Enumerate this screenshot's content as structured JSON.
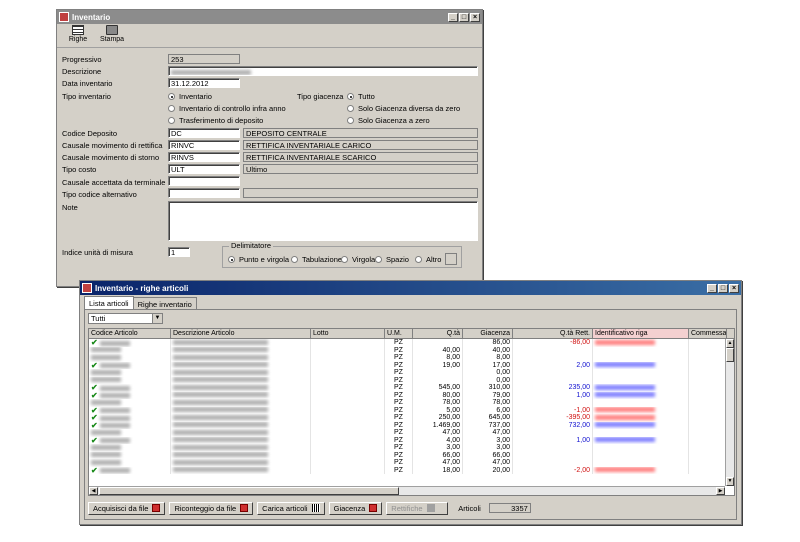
{
  "win1": {
    "title": "Inventario",
    "toolbar": {
      "righe": "Righe",
      "stampa": "Stampa"
    },
    "labels": {
      "progressivo": "Progressivo",
      "descrizione": "Descrizione",
      "data": "Data inventario",
      "tipo_inv": "Tipo inventario",
      "tipo_giac": "Tipo giacenza",
      "codice_deposito": "Codice Deposito",
      "causale_rettifica": "Causale movimento di rettifica",
      "causale_storno": "Causale movimento di storno",
      "tipo_costo": "Tipo costo",
      "causale_terminale": "Causale accettata da terminale",
      "tipo_codice_alt": "Tipo codice alternativo",
      "note": "Note",
      "indice_um": "Indice unità di misura"
    },
    "values": {
      "progressivo": "253",
      "data": "31.12.2012",
      "codice_deposito": "DC",
      "codice_deposito_desc": "DEPOSITO CENTRALE",
      "causale_rettifica": "RINVC",
      "causale_rettifica_desc": "RETTIFICA INVENTARIALE CARICO",
      "causale_storno": "RINVS",
      "causale_storno_desc": "RETTIFICA INVENTARIALE SCARICO",
      "tipo_costo": "ULT",
      "tipo_costo_desc": "Ultimo",
      "indice_um": "1"
    },
    "tipo_inventario": [
      "Inventario",
      "Inventario di controllo infra anno",
      "Trasferimento di deposito"
    ],
    "tipo_giacenza": [
      "Tutto",
      "Solo Giacenza diversa da zero",
      "Solo Giacenza a zero"
    ],
    "delimitatore": {
      "title": "Delimitatore",
      "options": [
        "Punto e virgola",
        "Tabulazione",
        "Virgola",
        "Spazio",
        "Altro"
      ]
    }
  },
  "win2": {
    "title": "Inventario - righe articoli",
    "tabs": [
      "Lista articoli",
      "Righe inventario"
    ],
    "filter": "Tutti",
    "columns": [
      "Codice Articolo",
      "Descrizione Articolo",
      "Lotto",
      "U.M.",
      "Q.tà",
      "Giacenza",
      "Q.tà Rett.",
      "Identificativo riga",
      "Commessa"
    ],
    "rows": [
      {
        "check": true,
        "um": "PZ",
        "qta": "",
        "giac": "86,00",
        "rett": "-86,00",
        "rc": "neg"
      },
      {
        "check": false,
        "um": "PZ",
        "qta": "40,00",
        "giac": "40,00",
        "rett": "",
        "rc": ""
      },
      {
        "check": false,
        "um": "PZ",
        "qta": "8,00",
        "giac": "8,00",
        "rett": "",
        "rc": ""
      },
      {
        "check": true,
        "um": "PZ",
        "qta": "19,00",
        "giac": "17,00",
        "rett": "2,00",
        "rc": "pos"
      },
      {
        "check": false,
        "um": "PZ",
        "qta": "",
        "giac": "0,00",
        "rett": "",
        "rc": ""
      },
      {
        "check": false,
        "um": "PZ",
        "qta": "",
        "giac": "0,00",
        "rett": "",
        "rc": ""
      },
      {
        "check": true,
        "um": "PZ",
        "qta": "545,00",
        "giac": "310,00",
        "rett": "235,00",
        "rc": "pos"
      },
      {
        "check": true,
        "um": "PZ",
        "qta": "80,00",
        "giac": "79,00",
        "rett": "1,00",
        "rc": "pos"
      },
      {
        "check": false,
        "um": "PZ",
        "qta": "78,00",
        "giac": "78,00",
        "rett": "",
        "rc": ""
      },
      {
        "check": true,
        "um": "PZ",
        "qta": "5,00",
        "giac": "6,00",
        "rett": "-1,00",
        "rc": "neg"
      },
      {
        "check": true,
        "um": "PZ",
        "qta": "250,00",
        "giac": "645,00",
        "rett": "-395,00",
        "rc": "neg"
      },
      {
        "check": true,
        "um": "PZ",
        "qta": "1.469,00",
        "giac": "737,00",
        "rett": "732,00",
        "rc": "pos"
      },
      {
        "check": false,
        "um": "PZ",
        "qta": "47,00",
        "giac": "47,00",
        "rett": "",
        "rc": ""
      },
      {
        "check": true,
        "um": "PZ",
        "qta": "4,00",
        "giac": "3,00",
        "rett": "1,00",
        "rc": "pos"
      },
      {
        "check": false,
        "um": "PZ",
        "qta": "3,00",
        "giac": "3,00",
        "rett": "",
        "rc": ""
      },
      {
        "check": false,
        "um": "PZ",
        "qta": "66,00",
        "giac": "66,00",
        "rett": "",
        "rc": ""
      },
      {
        "check": false,
        "um": "PZ",
        "qta": "47,00",
        "giac": "47,00",
        "rett": "",
        "rc": ""
      },
      {
        "check": true,
        "um": "PZ",
        "qta": "18,00",
        "giac": "20,00",
        "rett": "-2,00",
        "rc": "neg"
      }
    ],
    "buttons": [
      "Acquisisci da file",
      "Riconteggio da file",
      "Carica articoli",
      "Giacenza",
      "Rettifiche"
    ],
    "articoli_label": "Articoli",
    "articoli_count": "3357"
  },
  "colors": {
    "pos": "#1010d0",
    "neg": "#d01010",
    "title_active": "#0a246a",
    "title_inactive": "#8c8c8c"
  }
}
